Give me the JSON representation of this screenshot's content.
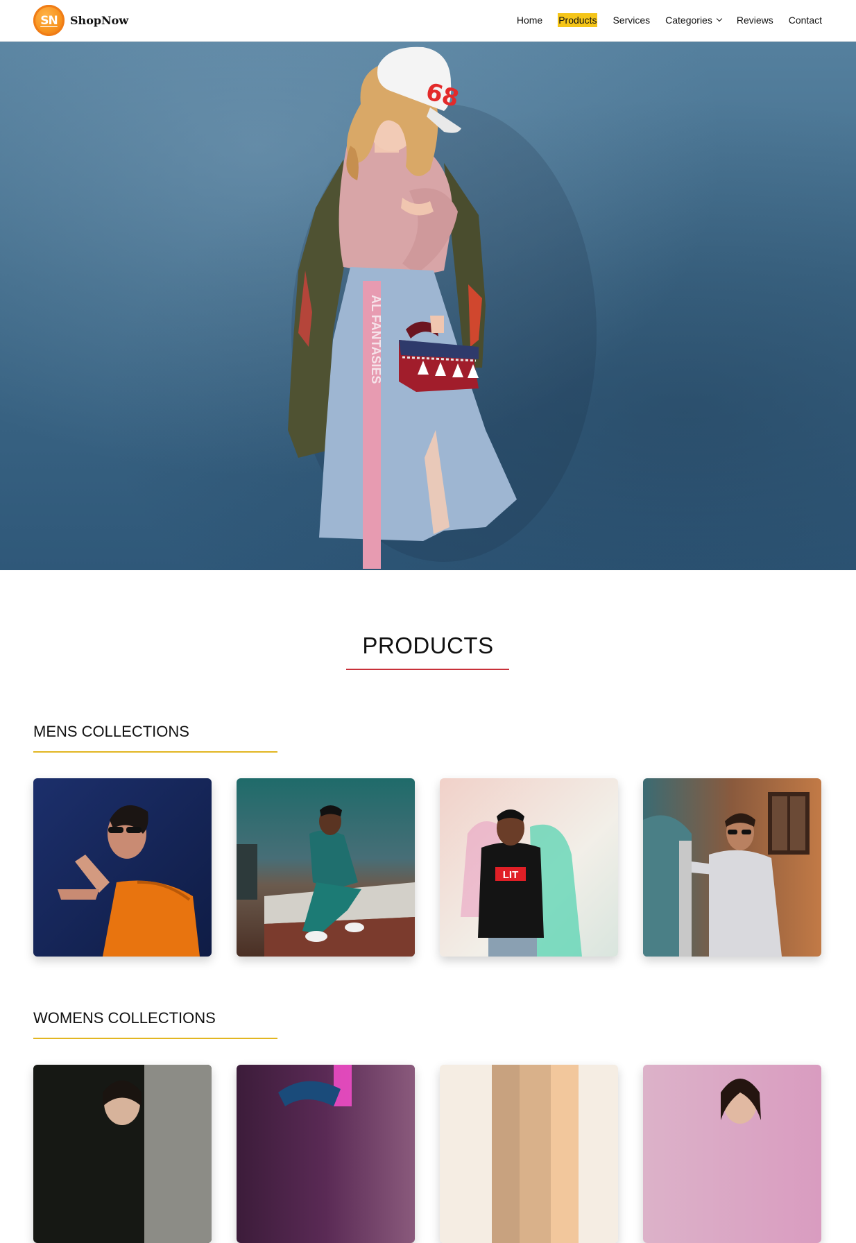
{
  "header": {
    "logo_badge": "SN",
    "logo_text": "ShopNow",
    "nav": [
      {
        "label": "Home"
      },
      {
        "label": "Products",
        "active": true
      },
      {
        "label": "Services"
      },
      {
        "label": "Categories",
        "has_dropdown": true
      },
      {
        "label": "Reviews"
      },
      {
        "label": "Contact"
      }
    ]
  },
  "hero": {
    "cap_text": "68",
    "ribbon_text": "AL FANTASIES"
  },
  "products": {
    "title": "PRODUCTS",
    "mens": {
      "title": "MENS COLLECTIONS",
      "cards": [
        "orange-sweater-man",
        "denim-man-sitting",
        "lit-sweatshirt-man",
        "white-sweater-man"
      ]
    },
    "womens": {
      "title": "WOMENS COLLECTIONS",
      "cards": [
        "dark-portrait-woman",
        "purple-neon-woman",
        "beige-fabric",
        "pink-portrait-woman"
      ]
    },
    "lit_text": "LIT"
  },
  "colors": {
    "accent_highlight": "#f5c518",
    "products_underline": "#c8313a",
    "collection_underline": "#e2b622",
    "hero_background": "#3f6a89"
  }
}
